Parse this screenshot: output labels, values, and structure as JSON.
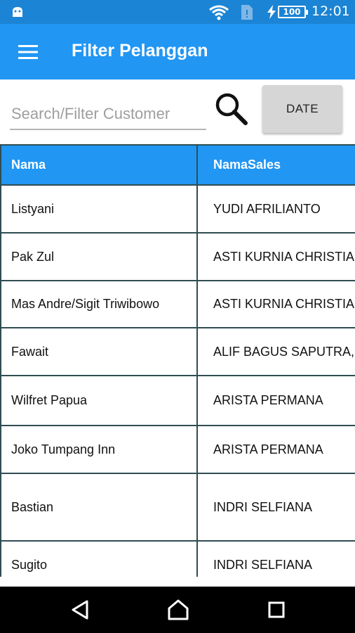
{
  "status_bar": {
    "battery_level": "100",
    "time": "12:01"
  },
  "app_bar": {
    "title": "Filter Pelanggan"
  },
  "search": {
    "placeholder": "Search/Filter Customer",
    "value": "",
    "date_button_label": "DATE"
  },
  "table": {
    "columns": [
      "Nama",
      "NamaSales"
    ],
    "rows": [
      {
        "nama": "Listyani",
        "sales": "YUDI AFRILIANTO"
      },
      {
        "nama": "Pak Zul",
        "sales": "ASTI KURNIA CHRISTIANA"
      },
      {
        "nama": "Mas Andre/Sigit Triwibowo",
        "sales": "ASTI KURNIA CHRISTIANA"
      },
      {
        "nama": "Fawait",
        "sales": "ALIF BAGUS SAPUTRA, DKK"
      },
      {
        "nama": "Wilfret Papua",
        "sales": "ARISTA PERMANA"
      },
      {
        "nama": "Joko Tumpang Inn",
        "sales": "ARISTA PERMANA"
      },
      {
        "nama": "Bastian",
        "sales": "INDRI SELFIANA"
      },
      {
        "nama": "Sugito",
        "sales": "INDRI SELFIANA"
      }
    ]
  },
  "colors": {
    "status_bar": "#1b84d4",
    "app_bar": "#2196f3",
    "table_header": "#2196f3",
    "grid_line": "#2e4d52"
  },
  "icons": {
    "status": [
      "android-icon",
      "wifi-icon",
      "sim-icon",
      "charging-icon",
      "battery-icon"
    ],
    "app_bar": "menu-icon",
    "search": "search-icon",
    "navigation": [
      "back-icon",
      "home-icon",
      "recents-icon"
    ]
  }
}
